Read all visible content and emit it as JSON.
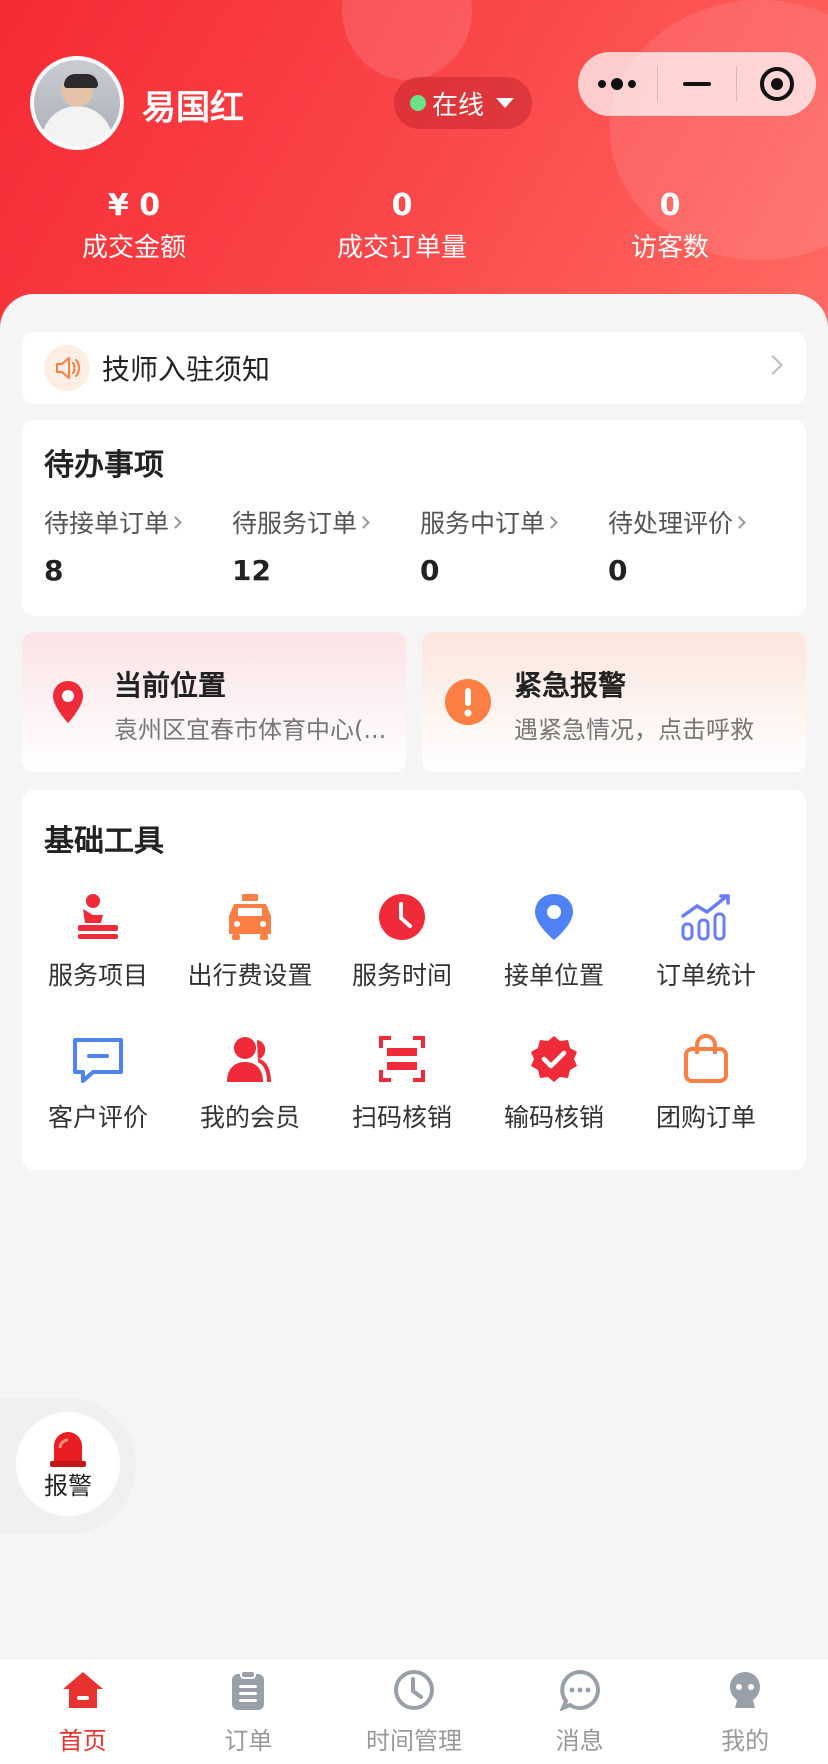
{
  "header": {
    "user_name": "易国红",
    "status": "在线",
    "stats": [
      {
        "value": "¥ 0",
        "label": "成交金额"
      },
      {
        "value": "0",
        "label": "成交订单量"
      },
      {
        "value": "0",
        "label": "访客数"
      }
    ]
  },
  "notice": {
    "label": "技师入驻须知"
  },
  "todo": {
    "title": "待办事项",
    "items": [
      {
        "label": "待接单订单",
        "count": "8"
      },
      {
        "label": "待服务订单",
        "count": "12"
      },
      {
        "label": "服务中订单",
        "count": "0"
      },
      {
        "label": "待处理评价",
        "count": "0"
      }
    ]
  },
  "quick": {
    "location": {
      "title": "当前位置",
      "subtitle": "袁州区宜春市体育中心(..."
    },
    "emergency": {
      "title": "紧急报警",
      "subtitle": "遇紧急情况，点击呼救"
    }
  },
  "tools": {
    "title": "基础工具",
    "items": [
      {
        "label": "服务项目",
        "icon": "stamp-icon"
      },
      {
        "label": "出行费设置",
        "icon": "taxi-icon"
      },
      {
        "label": "服务时间",
        "icon": "clock-icon"
      },
      {
        "label": "接单位置",
        "icon": "location-pin-icon"
      },
      {
        "label": "订单统计",
        "icon": "chart-icon"
      },
      {
        "label": "客户评价",
        "icon": "message-icon"
      },
      {
        "label": "我的会员",
        "icon": "members-icon"
      },
      {
        "label": "扫码核销",
        "icon": "scan-icon"
      },
      {
        "label": "输码核销",
        "icon": "verified-badge-icon"
      },
      {
        "label": "团购订单",
        "icon": "shopping-bag-icon"
      }
    ]
  },
  "alarm": {
    "label": "报警"
  },
  "tabbar": [
    {
      "label": "首页",
      "icon": "home-icon",
      "active": true
    },
    {
      "label": "订单",
      "icon": "clipboard-icon"
    },
    {
      "label": "时间管理",
      "icon": "clock-icon"
    },
    {
      "label": "消息",
      "icon": "chat-icon"
    },
    {
      "label": "我的",
      "icon": "profile-icon"
    }
  ],
  "colors": {
    "brand_red": "#f52a35",
    "active_tab": "#e8322f",
    "blue": "#4f83f5",
    "orange": "#fb7e45"
  }
}
